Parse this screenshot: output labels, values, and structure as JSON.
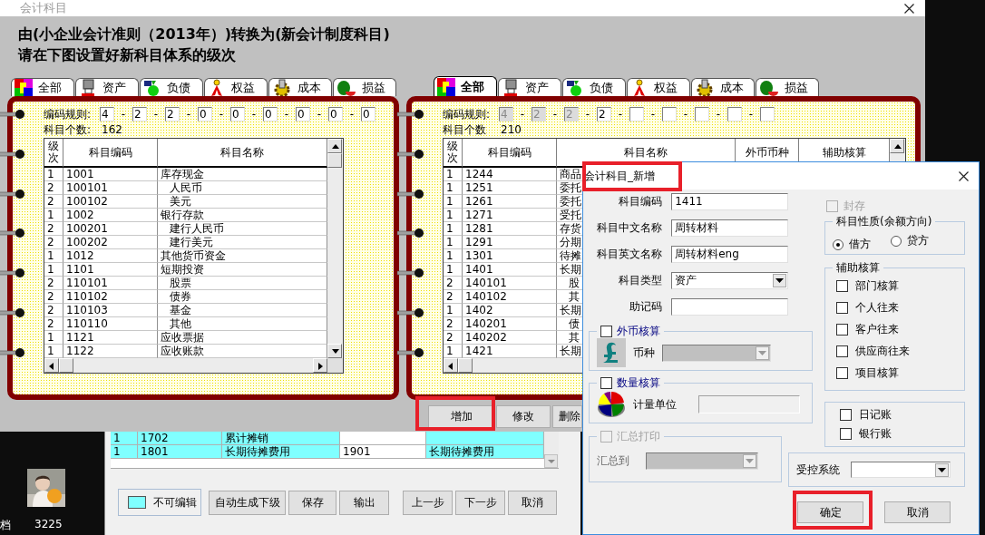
{
  "main_window": {
    "title": "会计科目",
    "heading": [
      "由(小企业会计准则（2013年）)转换为(新会计制度科目)",
      "请在下图设置好新科目体系的级次"
    ],
    "source_book": {
      "tabs": [
        {
          "label": "全部",
          "selected": false
        },
        {
          "label": "资产",
          "selected": false
        },
        {
          "label": "负债",
          "selected": false
        },
        {
          "label": "权益",
          "selected": false
        },
        {
          "label": "成本",
          "selected": false
        },
        {
          "label": "损益",
          "selected": false
        }
      ],
      "code_rule_label": "编码规则:",
      "separator": "-",
      "code_rule": [
        {
          "value": "4",
          "disabled": false
        },
        {
          "value": "2",
          "disabled": false
        },
        {
          "value": "2",
          "disabled": false
        },
        {
          "value": "0",
          "disabled": false
        },
        {
          "value": "0",
          "disabled": false
        },
        {
          "value": "0",
          "disabled": false
        },
        {
          "value": "0",
          "disabled": false
        },
        {
          "value": "0",
          "disabled": false
        },
        {
          "value": "0",
          "disabled": false
        }
      ],
      "count_label": "科目个数:",
      "count": "162",
      "columns": [
        "级次",
        "科目编码",
        "科目名称"
      ],
      "rows": [
        {
          "level": "1",
          "code": "1001",
          "name": "库存现金",
          "indented": false
        },
        {
          "level": "2",
          "code": "100101",
          "name": "人民币",
          "indented": true
        },
        {
          "level": "2",
          "code": "100102",
          "name": "美元",
          "indented": true
        },
        {
          "level": "1",
          "code": "1002",
          "name": "银行存款",
          "indented": false
        },
        {
          "level": "2",
          "code": "100201",
          "name": "建行人民币",
          "indented": true
        },
        {
          "level": "2",
          "code": "100202",
          "name": "建行美元",
          "indented": true
        },
        {
          "level": "1",
          "code": "1012",
          "name": "其他货币资金",
          "indented": false
        },
        {
          "level": "1",
          "code": "1101",
          "name": "短期投资",
          "indented": false
        },
        {
          "level": "2",
          "code": "110101",
          "name": "股票",
          "indented": true
        },
        {
          "level": "2",
          "code": "110102",
          "name": "债券",
          "indented": true
        },
        {
          "level": "2",
          "code": "110103",
          "name": "基金",
          "indented": true
        },
        {
          "level": "2",
          "code": "110110",
          "name": "其他",
          "indented": true
        },
        {
          "level": "1",
          "code": "1121",
          "name": "应收票据",
          "indented": false
        },
        {
          "level": "1",
          "code": "1122",
          "name": "应收账款",
          "indented": false
        }
      ]
    },
    "target_book": {
      "tabs": [
        {
          "label": "全部",
          "selected": true
        },
        {
          "label": "资产",
          "selected": false
        },
        {
          "label": "负债",
          "selected": false
        },
        {
          "label": "权益",
          "selected": false
        },
        {
          "label": "成本",
          "selected": false
        },
        {
          "label": "损益",
          "selected": false
        }
      ],
      "code_rule_label": "编码规则:",
      "separator": "-",
      "code_rule": [
        {
          "value": "4",
          "disabled": true
        },
        {
          "value": "2",
          "disabled": true
        },
        {
          "value": "2",
          "disabled": true
        },
        {
          "value": "2",
          "disabled": false
        },
        {
          "disabled": false
        },
        {
          "disabled": false
        },
        {
          "disabled": false
        },
        {
          "disabled": false
        },
        {
          "disabled": false
        }
      ],
      "count_label": "科目个数",
      "count": "210",
      "columns": [
        "级次",
        "科目编码",
        "科目名称",
        "外币币种",
        "辅助核算"
      ],
      "rows": [
        {
          "level": "1",
          "code": "1244",
          "name": "商品",
          "indented": false
        },
        {
          "level": "1",
          "code": "1251",
          "name": "委托",
          "indented": false
        },
        {
          "level": "1",
          "code": "1261",
          "name": "委托",
          "indented": false
        },
        {
          "level": "1",
          "code": "1271",
          "name": "受托",
          "indented": false
        },
        {
          "level": "1",
          "code": "1281",
          "name": "存货",
          "indented": false
        },
        {
          "level": "1",
          "code": "1291",
          "name": "分期",
          "indented": false
        },
        {
          "level": "1",
          "code": "1301",
          "name": "待摊",
          "indented": false
        },
        {
          "level": "1",
          "code": "1401",
          "name": "长期",
          "indented": false
        },
        {
          "level": "2",
          "code": "140101",
          "name": "股",
          "indented": true
        },
        {
          "level": "2",
          "code": "140102",
          "name": "其",
          "indented": true
        },
        {
          "level": "1",
          "code": "1402",
          "name": "长期",
          "indented": false
        },
        {
          "level": "2",
          "code": "140201",
          "name": "债",
          "indented": true
        },
        {
          "level": "2",
          "code": "140202",
          "name": "其",
          "indented": true
        },
        {
          "level": "1",
          "code": "1421",
          "name": "长期",
          "indented": false
        }
      ]
    },
    "target_buttons": [
      "增加",
      "修改",
      "删除"
    ]
  },
  "back_window": {
    "rows": [
      {
        "level": "1",
        "code": "1702",
        "name": "累计摊销"
      },
      {
        "level": "1",
        "code": "1801",
        "name": "长期待摊费用",
        "new_code": "1901",
        "new_name": "长期待摊费用"
      }
    ],
    "legend": "不可编辑",
    "buttons": [
      "自动生成下级",
      "保存",
      "输出",
      "上一步",
      "下一步",
      "取消"
    ]
  },
  "desktop": {
    "labels": [
      "档",
      "3225"
    ]
  },
  "dialog": {
    "title": "会计科目_新增",
    "fields": [
      {
        "label": "科目编码",
        "value": "1411",
        "kind": "text"
      },
      {
        "label": "科目中文名称",
        "value": "周转材料",
        "kind": "text"
      },
      {
        "label": "科目英文名称",
        "value": "周转材料eng",
        "kind": "text"
      },
      {
        "label": "科目类型",
        "value": "资产",
        "kind": "select"
      },
      {
        "label": "助记码",
        "kind": "text"
      }
    ],
    "foreign_currency": {
      "label": "外币核算",
      "checked": false,
      "disabled": false,
      "field_label": "币种"
    },
    "quantity": {
      "label": "数量核算",
      "checked": false,
      "disabled": false,
      "field_label": "计量单位"
    },
    "summary_print": {
      "label": "汇总打印",
      "checked": false,
      "disabled": true,
      "field_label": "汇总到"
    },
    "archive": {
      "label": "封存",
      "checked": false,
      "disabled": true
    },
    "balance_direction": {
      "label": "科目性质(余额方向)",
      "options": [
        {
          "label": "借方",
          "selected": true
        },
        {
          "label": "贷方",
          "selected": false
        }
      ]
    },
    "auxiliary": {
      "label": "辅助核算",
      "items": [
        {
          "label": "部门核算",
          "checked": false
        },
        {
          "label": "个人往来",
          "checked": false
        },
        {
          "label": "客户往来",
          "checked": false
        },
        {
          "label": "供应商往来",
          "checked": false
        },
        {
          "label": "项目核算",
          "checked": false
        }
      ]
    },
    "books": [
      {
        "label": "日记账",
        "checked": false
      },
      {
        "label": "银行账",
        "checked": false
      }
    ],
    "controlled_system": {
      "label": "受控系统"
    },
    "buttons": [
      "确定",
      "取消"
    ]
  }
}
